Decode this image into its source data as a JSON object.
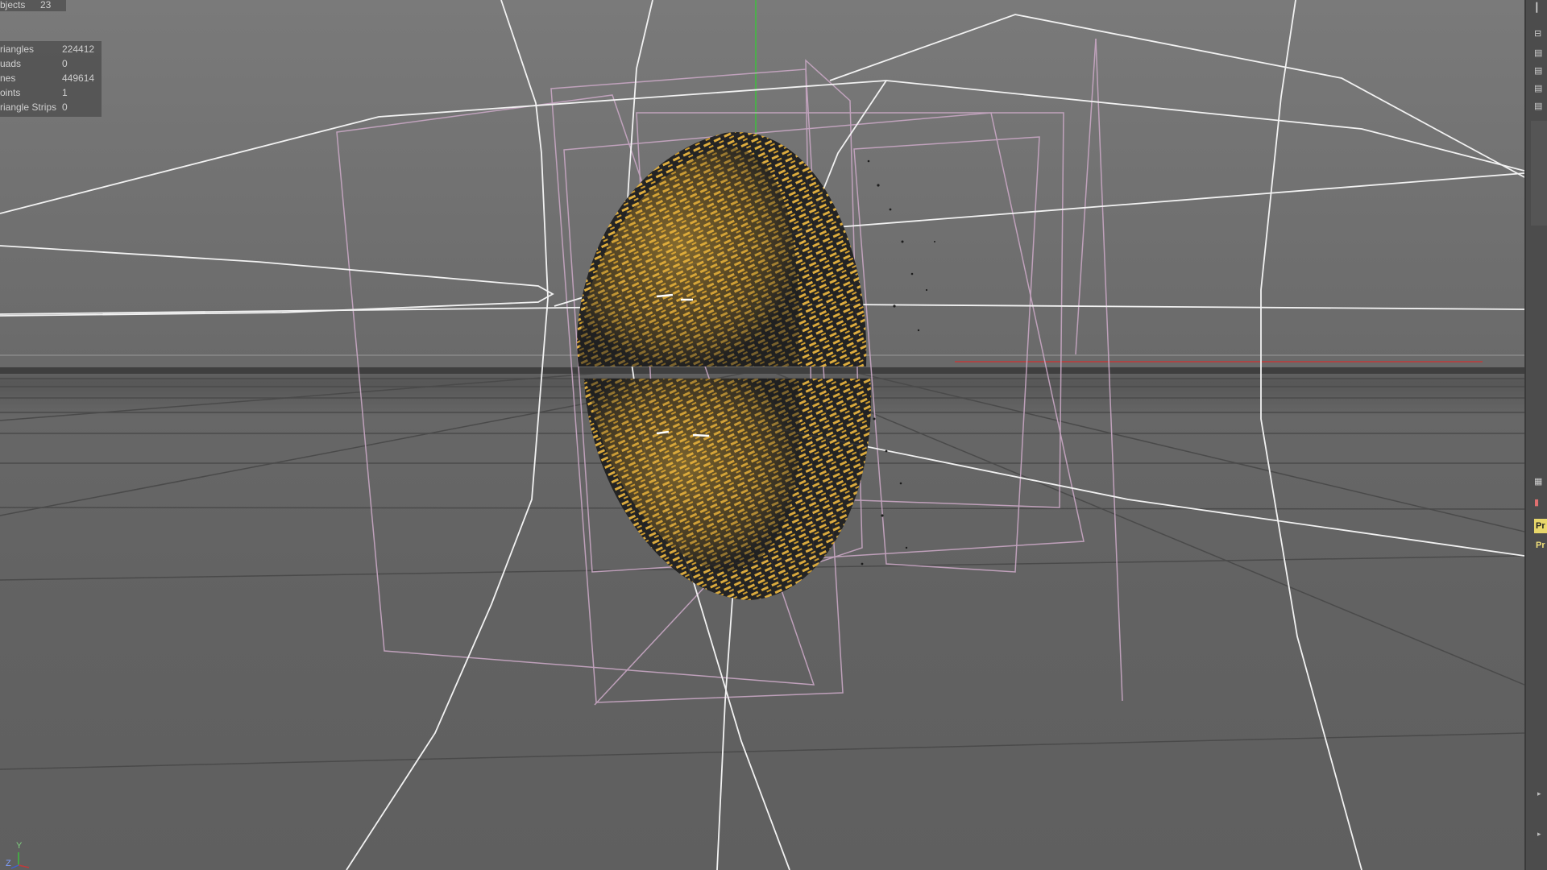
{
  "hud": {
    "objects_label": "bjects",
    "objects_value": "23",
    "stats": [
      {
        "label": "riangles",
        "value": "224412"
      },
      {
        "label": "uads",
        "value": "0"
      },
      {
        "label": "nes",
        "value": "449614"
      },
      {
        "label": "oints",
        "value": "1"
      },
      {
        "label": "riangle Strips",
        "value": "0"
      }
    ]
  },
  "axis_gizmo": {
    "y": "Y",
    "z": "Z"
  },
  "right_panel": {
    "tag_label": "Pr",
    "tag_label_2": "Pr",
    "icons": [
      "collapse-icon",
      "list-icon",
      "list-icon",
      "list-icon",
      "list-icon",
      "grip-icon",
      "document-icon"
    ]
  },
  "colors": {
    "viewport_bg": "#6f6f6f",
    "spline_white": "#f2f2f2",
    "camera_frame_pink": "#c9a7c4",
    "particles_yellow": "#e7b23a",
    "particles_dark": "#1d1d1d",
    "x_axis_red": "#c03a3a",
    "y_axis_green": "#3fbf3f",
    "tag_yellow": "#e8d76a"
  }
}
